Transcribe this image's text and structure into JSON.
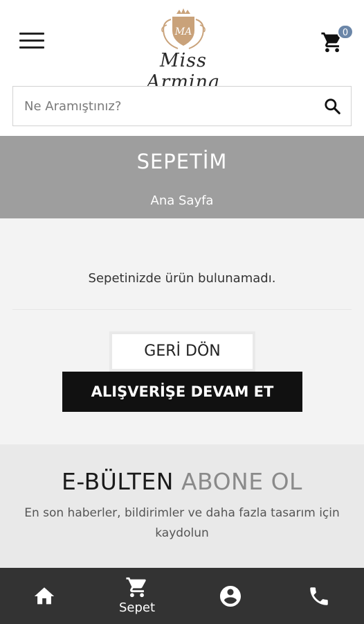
{
  "header": {
    "logo_text": "Miss Armina",
    "cart_count": "0"
  },
  "search": {
    "placeholder": "Ne Aramıştınız?"
  },
  "title_band": {
    "title": "SEPETİM",
    "breadcrumb": "Ana Sayfa"
  },
  "cart": {
    "empty_message": "Sepetinizde ürün bulunamadı.",
    "back_label": "GERİ DÖN",
    "continue_label": "ALIŞVERİŞE DEVAM ET"
  },
  "newsletter": {
    "title_dark": "E-BÜLTEN",
    "title_light": "ABONE OL",
    "description": "En son haberler, bildirimler ve daha fazla tasarım için kaydolun"
  },
  "bottom_nav": {
    "items": [
      {
        "icon": "home-icon",
        "label": ""
      },
      {
        "icon": "cart-icon",
        "label": "Sepet"
      },
      {
        "icon": "account-icon",
        "label": ""
      },
      {
        "icon": "phone-icon",
        "label": ""
      }
    ]
  },
  "colors": {
    "title_band": "#9e9e9e",
    "content_bg": "#f3f3f3",
    "newsletter_bg": "#e9e9e9",
    "bottom_nav": "#333333",
    "badge": "#6b86a8",
    "logo_gold": "#c9a27a"
  }
}
